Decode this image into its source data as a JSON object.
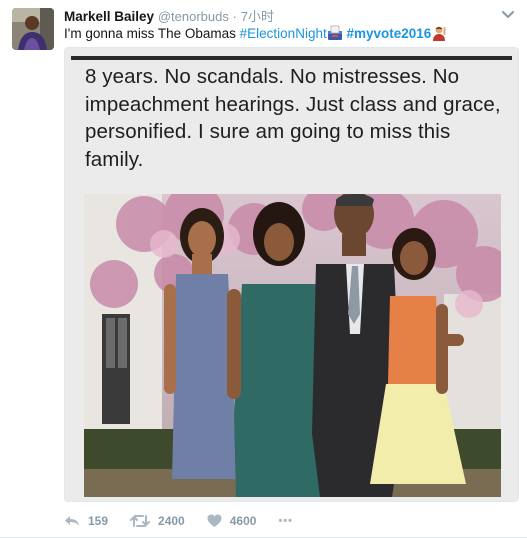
{
  "tweet": {
    "name": "Markell Bailey",
    "handle": "@tenorbuds",
    "separator": "·",
    "time": "7小时",
    "text_prefix": "I'm gonna miss The Obamas ",
    "hashtags": [
      "#ElectionNight",
      "#myvote2016"
    ],
    "emojis": [
      "ballot-box-emoji",
      "man-raising-hand-emoji"
    ]
  },
  "media": {
    "quote": "8 years. No scandals. No mistresses. No impeachment hearings. Just class and grace, personified. I sure am going to miss this family."
  },
  "actions": {
    "reply_count": "159",
    "retweet_count": "2400",
    "like_count": "4600",
    "more_label": "•••"
  },
  "icons": [
    "chevron-down-icon",
    "reply-icon",
    "retweet-icon",
    "heart-icon",
    "more-icon"
  ],
  "colors": {
    "hashtag": "#1b95e0",
    "meta": "#8899a6",
    "text": "#14171a"
  }
}
